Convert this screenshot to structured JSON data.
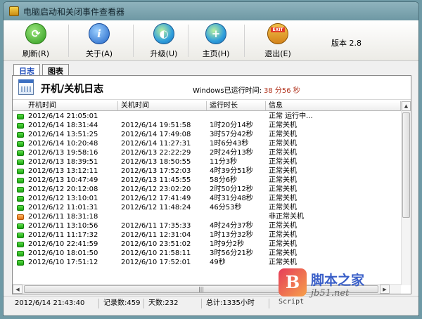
{
  "window": {
    "title": "电脑启动和关闭事件查看器"
  },
  "toolbar": {
    "refresh_label": "刷新(R)",
    "about_label": "关于(A)",
    "upgrade_label": "升级(U)",
    "home_label": "主页(H)",
    "exit_label": "退出(E)",
    "exit_icon_text": "EXIT",
    "version": "版本 2.8"
  },
  "tabs": [
    {
      "label": "日志",
      "active": true
    },
    {
      "label": "图表",
      "active": false
    }
  ],
  "panel": {
    "title": "开机/关机日志",
    "uptime_label": "Windows已运行时间:",
    "uptime_value": "38 分56 秒"
  },
  "table": {
    "columns": [
      "开机时间",
      "关机时间",
      "运行时长",
      "信息"
    ],
    "rows": [
      {
        "status": "ok",
        "start": "2012/6/14 21:05:01",
        "end": "",
        "duration": "",
        "info": "正常 运行中..."
      },
      {
        "status": "ok",
        "start": "2012/6/14 18:31:44",
        "end": "2012/6/14 19:51:58",
        "duration": "1时20分14秒",
        "info": "正常关机"
      },
      {
        "status": "ok",
        "start": "2012/6/14 13:51:25",
        "end": "2012/6/14 17:49:08",
        "duration": "3时57分42秒",
        "info": "正常关机"
      },
      {
        "status": "ok",
        "start": "2012/6/14 10:20:48",
        "end": "2012/6/14 11:27:31",
        "duration": "1时6分43秒",
        "info": "正常关机"
      },
      {
        "status": "ok",
        "start": "2012/6/13 19:58:16",
        "end": "2012/6/13 22:22:29",
        "duration": "2时24分13秒",
        "info": "正常关机"
      },
      {
        "status": "ok",
        "start": "2012/6/13 18:39:51",
        "end": "2012/6/13 18:50:55",
        "duration": "11分3秒",
        "info": "正常关机"
      },
      {
        "status": "ok",
        "start": "2012/6/13 13:12:11",
        "end": "2012/6/13 17:52:03",
        "duration": "4时39分51秒",
        "info": "正常关机"
      },
      {
        "status": "ok",
        "start": "2012/6/13 10:47:49",
        "end": "2012/6/13 11:45:55",
        "duration": "58分6秒",
        "info": "正常关机"
      },
      {
        "status": "ok",
        "start": "2012/6/12 20:12:08",
        "end": "2012/6/12 23:02:20",
        "duration": "2时50分12秒",
        "info": "正常关机"
      },
      {
        "status": "ok",
        "start": "2012/6/12 13:10:01",
        "end": "2012/6/12 17:41:49",
        "duration": "4时31分48秒",
        "info": "正常关机"
      },
      {
        "status": "ok",
        "start": "2012/6/12 11:01:31",
        "end": "2012/6/12 11:48:24",
        "duration": "46分53秒",
        "info": "正常关机"
      },
      {
        "status": "bad",
        "start": "2012/6/11 18:31:18",
        "end": "",
        "duration": "",
        "info": "非正常关机"
      },
      {
        "status": "ok",
        "start": "2012/6/11 13:10:56",
        "end": "2012/6/11 17:35:33",
        "duration": "4时24分37秒",
        "info": "正常关机"
      },
      {
        "status": "ok",
        "start": "2012/6/11 11:17:32",
        "end": "2012/6/11 12:31:04",
        "duration": "1时13分32秒",
        "info": "正常关机"
      },
      {
        "status": "ok",
        "start": "2012/6/10 22:41:59",
        "end": "2012/6/10 23:51:02",
        "duration": "1时9分2秒",
        "info": "正常关机"
      },
      {
        "status": "ok",
        "start": "2012/6/10 18:01:50",
        "end": "2012/6/10 21:58:11",
        "duration": "3时56分21秒",
        "info": "正常关机"
      },
      {
        "status": "ok",
        "start": "2012/6/10 17:51:12",
        "end": "2012/6/10 17:52:01",
        "duration": "49秒",
        "info": "正常关机"
      }
    ]
  },
  "statusbar": {
    "time": "2012/6/14 21:43:40",
    "records": "记录数:459",
    "days": "天数:232",
    "total": "总计:1335小时"
  },
  "watermark": {
    "logo_letter": "B",
    "site_cn": "脚本之家",
    "url": "jb51.net",
    "script": "Script"
  },
  "colors": {
    "accent": "#1a48b8",
    "uptime": "#b0301a",
    "status_ok": "#19a10f",
    "status_bad": "#e07012"
  }
}
